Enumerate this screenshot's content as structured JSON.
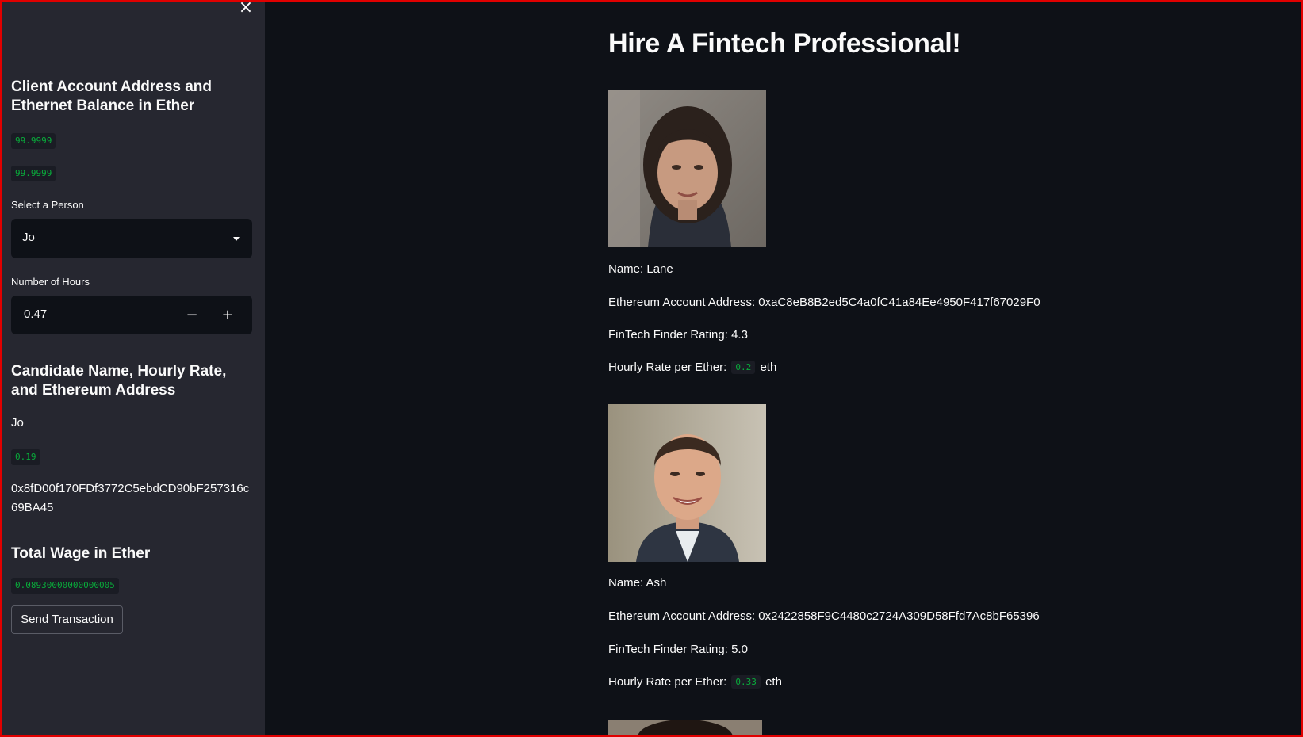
{
  "sidebar": {
    "close_icon": "close-icon",
    "balance_heading": "Client Account Address and Ethernet Balance in Ether",
    "balance_values": [
      "99.9999",
      "99.9999"
    ],
    "select_label": "Select a Person",
    "selected_person": "Jo",
    "hours_label": "Number of Hours",
    "hours_value": "0.47",
    "decrement_icon": "minus-icon",
    "increment_icon": "plus-icon",
    "candidate_heading": "Candidate Name, Hourly Rate, and Ethereum Address",
    "candidate_name": "Jo",
    "candidate_rate": "0.19",
    "candidate_address": "0x8fD00f170FDf3772C5ebdCD90bF257316c69BA45",
    "wage_heading": "Total Wage in Ether",
    "wage_value": "0.08930000000000005",
    "send_button": "Send Transaction"
  },
  "main": {
    "title": "Hire A Fintech Professional!",
    "candidates": [
      {
        "name_line": "Name: Lane",
        "address_line": "Ethereum Account Address: 0xaC8eB8B2ed5C4a0fC41a84Ee4950F417f67029F0",
        "rating_line": "FinTech Finder Rating: 4.3",
        "rate_label": "Hourly Rate per Ether:",
        "rate_value": "0.2",
        "rate_unit": "eth"
      },
      {
        "name_line": "Name: Ash",
        "address_line": "Ethereum Account Address: 0x2422858F9C4480c2724A309D58Ffd7Ac8bF65396",
        "rating_line": "FinTech Finder Rating: 5.0",
        "rate_label": "Hourly Rate per Ether:",
        "rate_value": "0.33",
        "rate_unit": "eth"
      }
    ]
  },
  "colors": {
    "app_background": "#0e1117",
    "sidebar_background": "#262730",
    "code_text": "#09ab3b",
    "window_border": "#e00000"
  }
}
